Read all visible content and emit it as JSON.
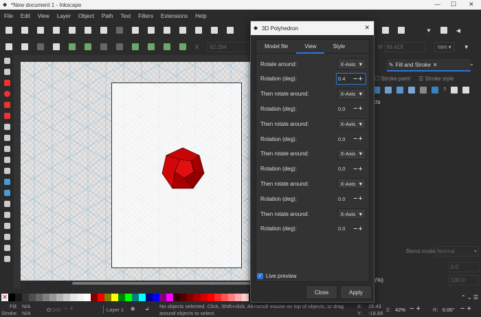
{
  "window": {
    "title": "*New document 1 - Inkscape"
  },
  "menu": [
    "File",
    "Edit",
    "View",
    "Layer",
    "Object",
    "Path",
    "Text",
    "Filters",
    "Extensions",
    "Help"
  ],
  "toolbar2": {
    "x_label": "X",
    "x_value": "62.294",
    "h_label": "H",
    "h_value": "99.419",
    "unit": "mm"
  },
  "right_panel": {
    "tab": "Fill and Stroke",
    "subtabs": [
      "Stroke paint",
      "Stroke style"
    ],
    "objects_text": "jects",
    "blend_label": "Blend mode",
    "blend_value": "Normal",
    "blur_value": "0.0",
    "opacity_label": "ty (%)",
    "opacity_value": "100.0"
  },
  "dialog": {
    "title": "3D Polyhedron",
    "tabs": [
      "Model file",
      "View",
      "Style"
    ],
    "active_tab": "View",
    "rows": [
      {
        "label": "Rotate around:",
        "type": "select",
        "value": "X-Axis"
      },
      {
        "label": "Rotation (deg):",
        "type": "spin",
        "value": "0.4"
      },
      {
        "label": "Then rotate around:",
        "type": "select",
        "value": "X-Axis"
      },
      {
        "label": "Rotation (deg):",
        "type": "spin",
        "value": "0.0"
      },
      {
        "label": "Then rotate around:",
        "type": "select",
        "value": "X-Axis"
      },
      {
        "label": "Rotation (deg):",
        "type": "spin",
        "value": "0.0"
      },
      {
        "label": "Then rotate around:",
        "type": "select",
        "value": "X-Axis"
      },
      {
        "label": "Rotation (deg):",
        "type": "spin",
        "value": "0.0"
      },
      {
        "label": "Then rotate around:",
        "type": "select",
        "value": "X-Axis"
      },
      {
        "label": "Rotation (deg):",
        "type": "spin",
        "value": "0.0"
      },
      {
        "label": "Then rotate around:",
        "type": "select",
        "value": "X-Axis"
      },
      {
        "label": "Rotation (deg):",
        "type": "spin",
        "value": "0.0"
      }
    ],
    "live_preview_label": "Live preview",
    "live_preview": true,
    "close_label": "Close",
    "apply_label": "Apply"
  },
  "status": {
    "fill_label": "Fill:",
    "fill_value": "N/A",
    "stroke_label": "Stroke:",
    "stroke_value": "N/A",
    "opacity_label": "O:",
    "opacity_value": "100",
    "layer": "Layer 1",
    "message": "No objects selected. Click, Shift+click, Alt+scroll mouse on top of objects, or drag around objects to select.",
    "x_label": "X:",
    "x": "26.43",
    "y_label": "Y:",
    "y": "-18.88",
    "zoom_label": "Z:",
    "zoom": "42%",
    "rotation_label": "R:",
    "rotation": "0.00°"
  },
  "colors": {
    "accent": "#2a78d6",
    "polyhedron": "#cc0000"
  }
}
